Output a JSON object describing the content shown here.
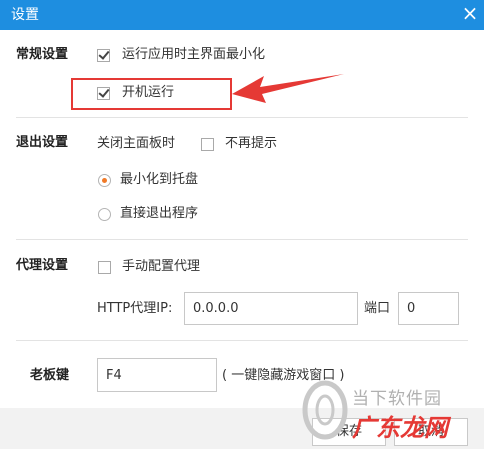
{
  "window": {
    "title": "设置",
    "close_glyph": "×"
  },
  "general": {
    "label": "常规设置",
    "minimize_on_run": {
      "label": "运行应用时主界面最小化",
      "checked": true
    },
    "run_on_startup": {
      "label": "开机运行",
      "checked": true
    }
  },
  "exit": {
    "label": "退出设置",
    "close_panel_label": "关闭主面板时",
    "no_prompt": {
      "label": "不再提示",
      "checked": false
    },
    "options": [
      {
        "label": "最小化到托盘",
        "selected": true
      },
      {
        "label": "直接退出程序",
        "selected": false
      }
    ]
  },
  "proxy": {
    "label": "代理设置",
    "manual": {
      "label": "手动配置代理",
      "checked": false
    },
    "ip_label": "HTTP代理IP:",
    "ip_value": "0.0.0.0",
    "port_label": "端口",
    "port_value": "0"
  },
  "boss_key": {
    "label": "老板键",
    "value": "F4",
    "hint": "( 一键隐藏游戏窗口 )"
  },
  "footer": {
    "save_label": "保存",
    "cancel_label": "取消"
  },
  "watermark": {
    "line1": "当下软件园",
    "line2": "广东龙网"
  },
  "colors": {
    "title_bar": "#1e8ee0",
    "radio_selected": "#f07a28",
    "annotation": "#e53935"
  }
}
